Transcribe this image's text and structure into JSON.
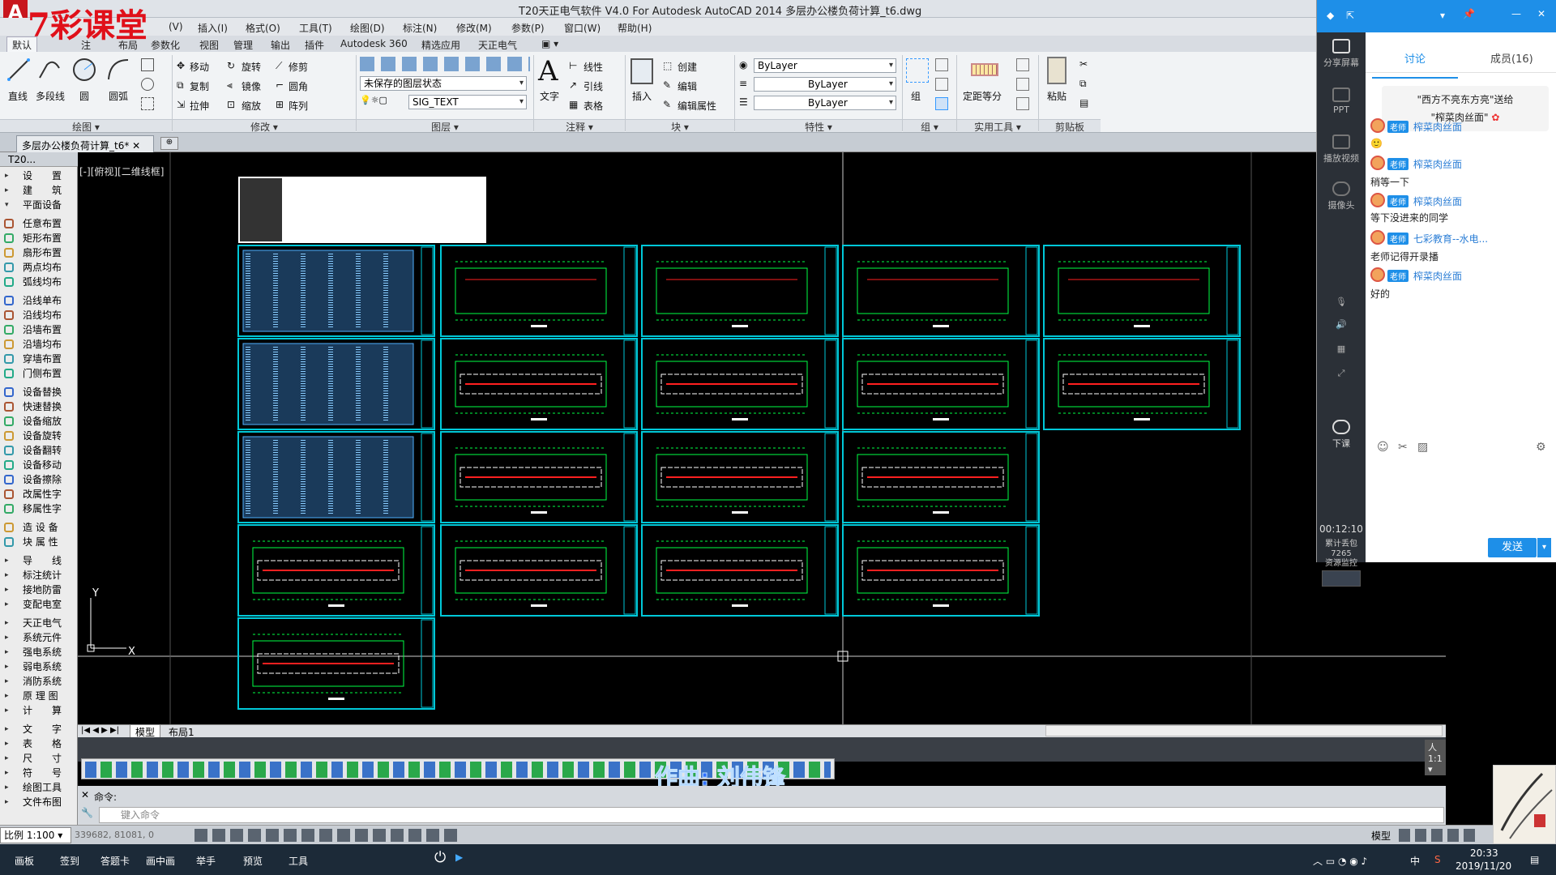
{
  "window": {
    "title": "T20天正电气软件 V4.0 For Autodesk AutoCAD 2014    多层办公楼负荷计算_t6.dwg",
    "app_logo": "A",
    "watermark": "7彩课堂"
  },
  "menubar": [
    "(V)",
    "插入(I)",
    "格式(O)",
    "工具(T)",
    "绘图(D)",
    "标注(N)",
    "修改(M)",
    "参数(P)",
    "窗口(W)",
    "帮助(H)"
  ],
  "ribbon_tabs": [
    "默认",
    "注",
    "布局",
    "参数化",
    "视图",
    "管理",
    "输出",
    "插件",
    "Autodesk 360",
    "精选应用",
    "天正电气"
  ],
  "ribbon": {
    "draw": {
      "title": "绘图 ▾",
      "line": "直线",
      "polyline": "多段线",
      "circle": "圆",
      "arc": "圆弧"
    },
    "modify": {
      "title": "修改 ▾",
      "move": "移动",
      "rotate": "旋转",
      "trim": "修剪",
      "copy": "复制",
      "mirror": "镜像",
      "fillet": "圆角",
      "stretch": "拉伸",
      "scale": "缩放",
      "array": "阵列"
    },
    "layers": {
      "title": "图层 ▾",
      "state": "未保存的图层状态",
      "current": "SIG_TEXT"
    },
    "annotation": {
      "title": "注释 ▾",
      "text": "文字",
      "linear": "线性",
      "leader": "引线",
      "table": "表格"
    },
    "block": {
      "title": "块 ▾",
      "insert": "插入",
      "create": "创建",
      "edit": "编辑",
      "edit_attr": "编辑属性"
    },
    "properties": {
      "title": "特性 ▾",
      "color": "ByLayer",
      "linetype": "ByLayer",
      "lineweight": "ByLayer"
    },
    "groups": {
      "title": "组 ▾",
      "group": "组"
    },
    "utilities": {
      "title": "实用工具 ▾",
      "measure": "定距等分"
    },
    "clipboard": {
      "title": "剪贴板",
      "paste": "粘贴"
    }
  },
  "document_tab": "多层办公楼负荷计算_t6*",
  "palette": {
    "title": "T20...",
    "items": [
      "设　　置",
      "建　　筑",
      "平面设备",
      "任意布置",
      "矩形布置",
      "扇形布置",
      "两点均布",
      "弧线均布",
      "沿线单布",
      "沿线均布",
      "沿墙布置",
      "沿墙均布",
      "穿墙布置",
      "门侧布置",
      "设备替换",
      "快速替换",
      "设备缩放",
      "设备旋转",
      "设备翻转",
      "设备移动",
      "设备擦除",
      "改属性字",
      "移属性字",
      "造 设 备",
      "块 属 性",
      "导　　线",
      "标注统计",
      "接地防雷",
      "变配电室",
      "天正电气",
      "系统元件",
      "强电系统",
      "弱电系统",
      "消防系统",
      "原 理 图",
      "计　　算",
      "文　　字",
      "表　　格",
      "尺　　寸",
      "符　　号",
      "绘图工具",
      "文件布图"
    ]
  },
  "viewport": {
    "label": "[-][俯视][二维线框]",
    "axis_y": "Y",
    "axis_x": "X"
  },
  "layout_tabs": [
    "模型",
    "布局1"
  ],
  "status": {
    "scale_label": "比例 1:100 ▾",
    "coords": "339682, 81081, 0",
    "annotation_scale": "人 1:1 ▾",
    "model": "模型"
  },
  "command": {
    "history": "命令:",
    "placeholder": "键入命令"
  },
  "subtitle": "作曲: 刘伟锋",
  "taskbar": {
    "items": [
      "画板",
      "签到",
      "答题卡",
      "画中画",
      "举手",
      "预览",
      "工具"
    ],
    "time": "20:33",
    "date": "2019/11/20",
    "ime": "中"
  },
  "chat": {
    "sidebar": [
      {
        "label": "分享屏幕",
        "icon": "share-screen-icon"
      },
      {
        "label": "PPT",
        "icon": "ppt-icon"
      },
      {
        "label": "播放视频",
        "icon": "play-video-icon"
      },
      {
        "label": "摄像头",
        "icon": "camera-icon"
      },
      {
        "label": "下课",
        "icon": "end-class-icon"
      }
    ],
    "timer": "00:12:10",
    "traffic_label": "累计丢包",
    "traffic_value": "7265",
    "monitor_label": "资源监控",
    "tabs": {
      "discuss": "讨论",
      "members": "成员(16)"
    },
    "gift_line1": "\"西方不亮东方亮\"送给",
    "gift_line2": "\"榨菜肉丝面\"",
    "messages": [
      {
        "badge": "老师",
        "name": "榨菜肉丝面",
        "text": "🙂"
      },
      {
        "badge": "老师",
        "name": "榨菜肉丝面",
        "text": "稍等一下"
      },
      {
        "badge": "老师",
        "name": "榨菜肉丝面",
        "text": "等下没进来的同学"
      },
      {
        "badge": "老师",
        "name": "七彩教育--水电...",
        "text": "老师记得开录播"
      },
      {
        "badge": "老师",
        "name": "榨菜肉丝面",
        "text": "好的"
      }
    ],
    "send": "发送"
  },
  "colors": {
    "accent": "#1e8fe8",
    "cad_bg": "#000000",
    "frame": "#00c8d8",
    "wire": "#00ff44",
    "red": "#ff2020"
  }
}
